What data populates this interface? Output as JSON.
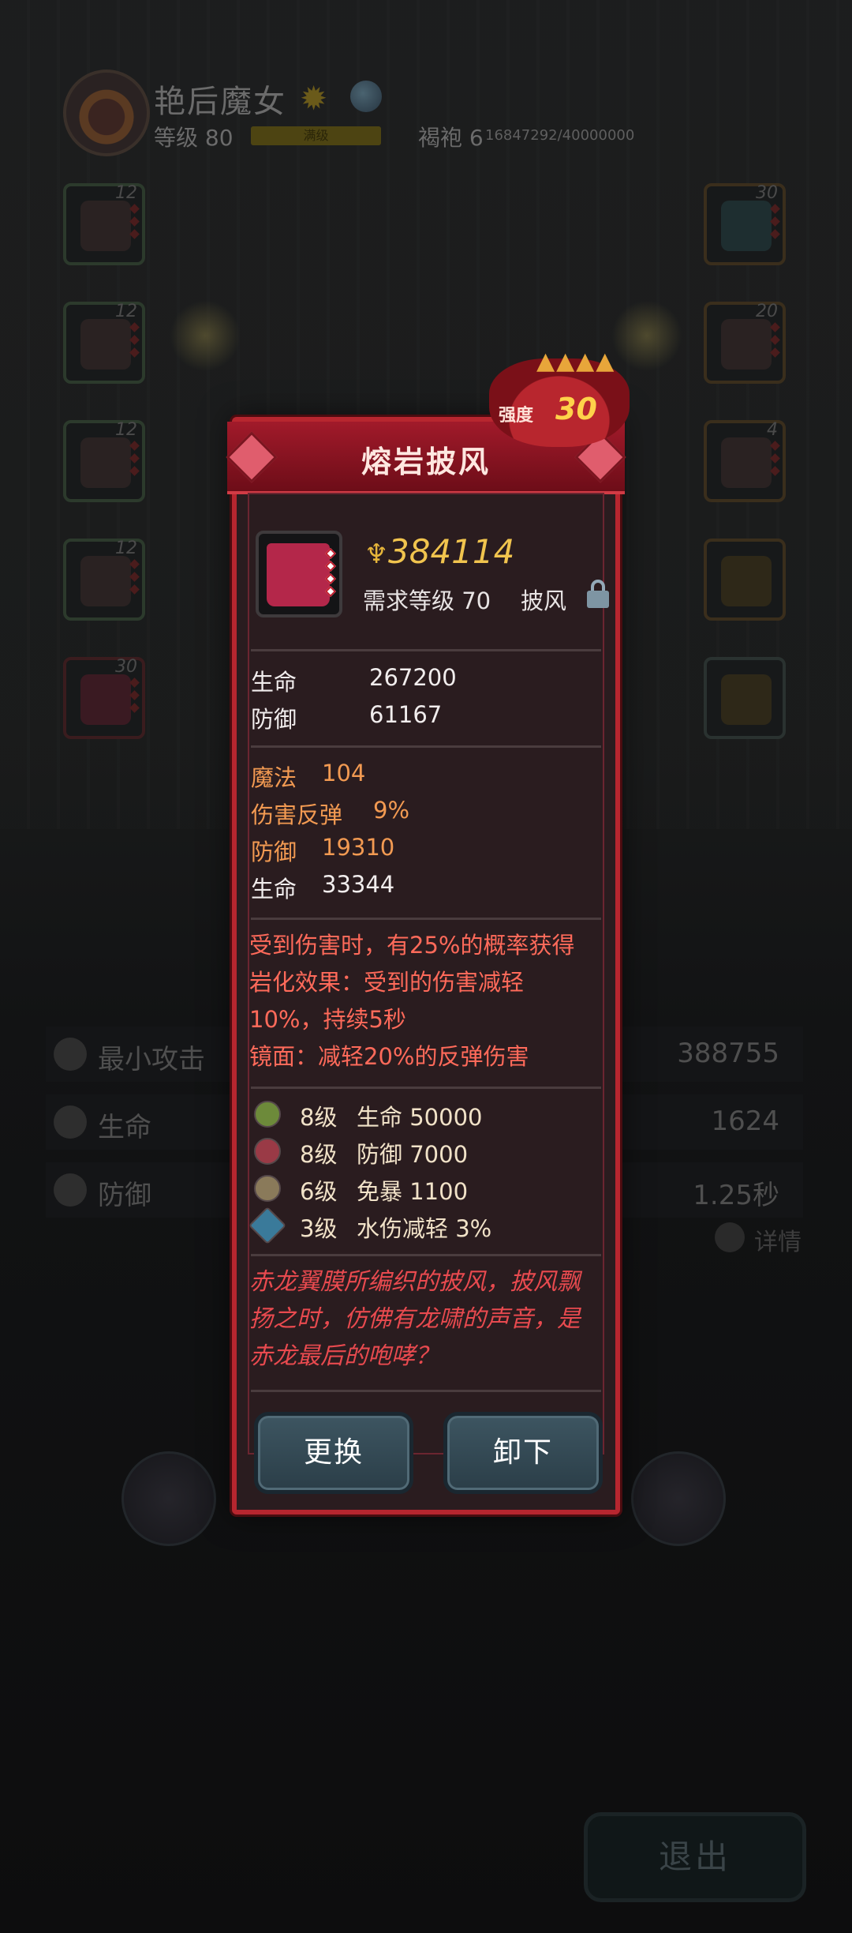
{
  "hero": {
    "name": "艳后魔女",
    "level_label": "等级 80",
    "level_bar_text": "满级",
    "robe_label": "褐袍 6",
    "robe_progress": "16847292/40000000"
  },
  "equipment_slots": {
    "left": [
      {
        "level": "12",
        "icon": "helmet-icon"
      },
      {
        "level": "12",
        "icon": "armor-icon"
      },
      {
        "level": "12",
        "icon": "gloves-icon"
      },
      {
        "level": "12",
        "icon": "boots-icon"
      },
      {
        "level": "30",
        "icon": "cape-icon"
      }
    ],
    "right": [
      {
        "level": "30",
        "icon": "crystal-weapon-icon"
      },
      {
        "level": "20",
        "icon": "ring-icon"
      },
      {
        "level": "4",
        "icon": "necklace-icon"
      },
      {
        "level": "",
        "icon": "amulet-icon"
      },
      {
        "level": "",
        "icon": "relic-icon"
      }
    ]
  },
  "stats": [
    {
      "label": "最小攻击",
      "value": "388755",
      "icon": "sword-icon"
    },
    {
      "label": "生命",
      "value": "1624",
      "icon": "heart-icon"
    },
    {
      "label": "防御",
      "value": "1.25秒",
      "icon": "shield-icon"
    }
  ],
  "details_label": "详情",
  "exit_label": "退出",
  "item": {
    "name": "熔岩披风",
    "strength_label": "强度",
    "strength": "30",
    "power": "384114",
    "requirement": "需求等级 70",
    "type": "披风",
    "base_stats": [
      {
        "label": "生命",
        "value": "267200"
      },
      {
        "label": "防御",
        "value": "61167"
      }
    ],
    "extra_stats": [
      {
        "label": "魔法",
        "value": "104",
        "color": "#f29a52"
      },
      {
        "label": "伤害反弹",
        "value": "9%",
        "color": "#f29a52"
      },
      {
        "label": "防御",
        "value": "19310",
        "color": "#f29a52"
      },
      {
        "label": "生命",
        "value": "33344",
        "color": "#f1eded"
      }
    ],
    "effect_lines": [
      "受到伤害时，有25%的概率获得",
      "岩化效果：受到的伤害减轻",
      "10%，持续5秒",
      "镜面：减轻20%的反弹伤害"
    ],
    "gems": [
      {
        "level": "8级",
        "desc": "生命 50000",
        "icon": "green-gem-icon",
        "color": "#6d8a3a"
      },
      {
        "level": "8级",
        "desc": "防御 7000",
        "icon": "red-gem-icon",
        "color": "#9a3a46"
      },
      {
        "level": "6级",
        "desc": "免暴 1100",
        "icon": "skull-gem-icon",
        "color": "#8a7a5a"
      },
      {
        "level": "3级",
        "desc": "水伤减轻 3%",
        "icon": "blue-gem-icon",
        "color": "#3a7a9a"
      }
    ],
    "flavor_lines": [
      "赤龙翼膜所编织的披风，披风飘",
      "扬之时，仿佛有龙啸的声音，是",
      "赤龙最后的咆哮？"
    ],
    "buttons": {
      "replace": "更换",
      "unequip": "卸下"
    }
  }
}
